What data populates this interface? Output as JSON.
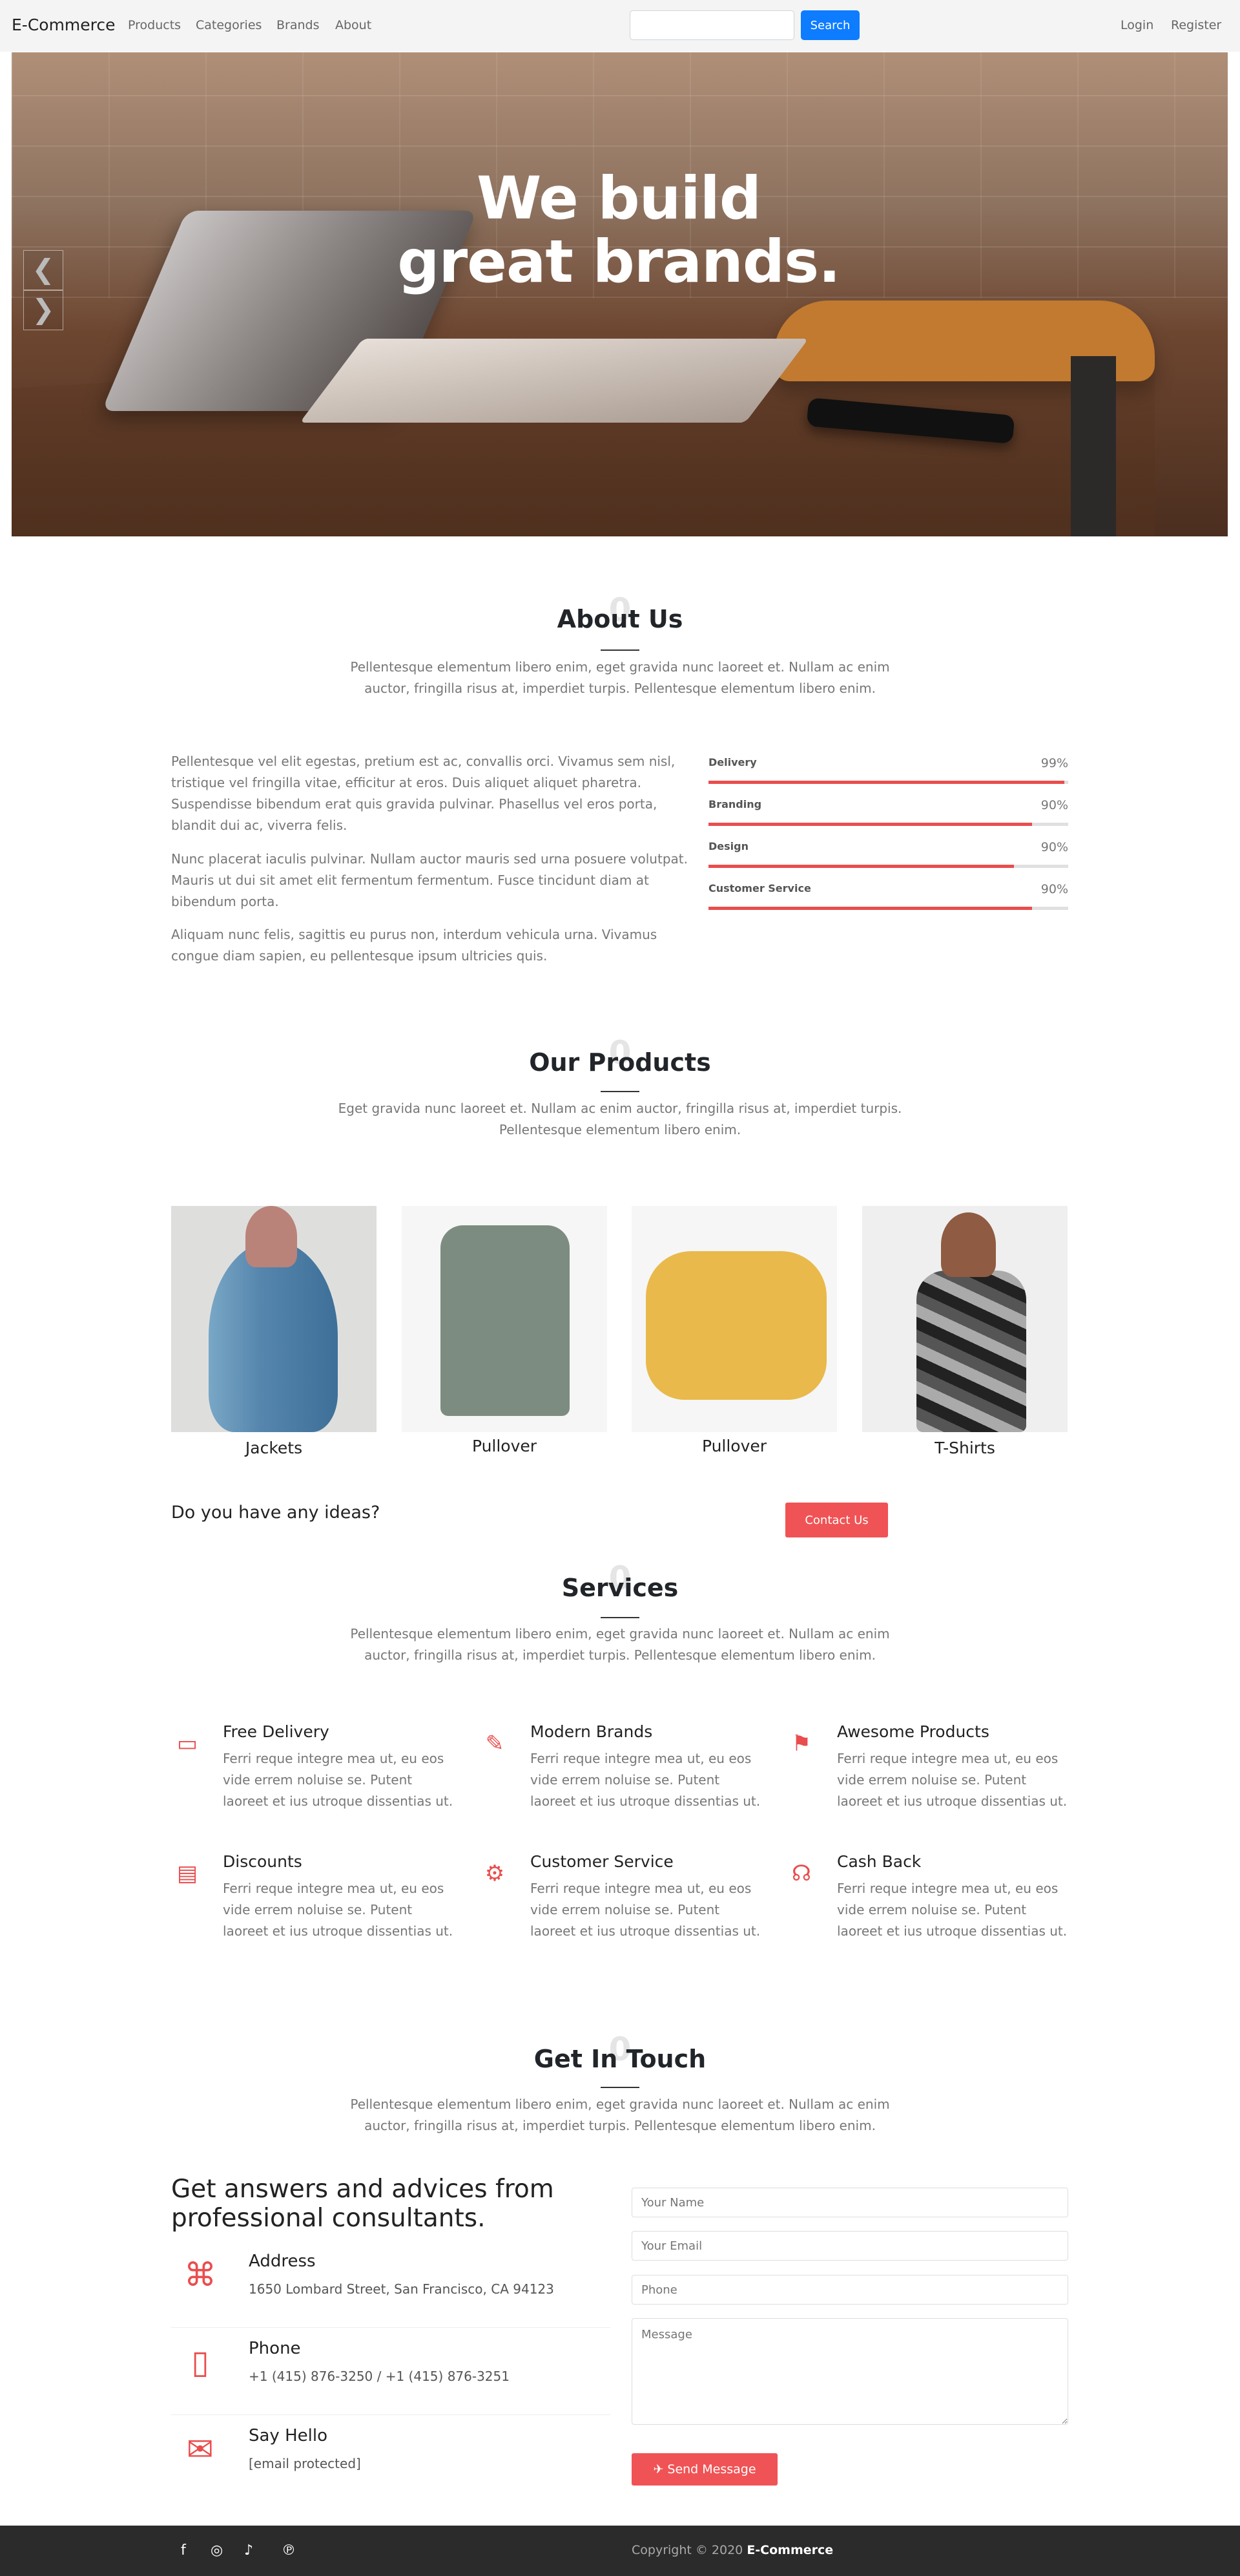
{
  "nav": {
    "brand": "E-Commerce",
    "links": [
      "Products",
      "Categories",
      "Brands",
      "About"
    ],
    "search_placeholder": "",
    "search_button": "Search",
    "login": "Login",
    "register": "Register"
  },
  "hero": {
    "headline": "We build great brands.",
    "prev": "❮",
    "next": "❯"
  },
  "about": {
    "title": "About Us",
    "number": "0",
    "subtitle": "Pellentesque elementum libero enim, eget gravida nunc laoreet et. Nullam ac enim auctor, fringilla risus at, imperdiet turpis. Pellentesque elementum libero enim.",
    "paragraphs": [
      "Pellentesque vel elit egestas, pretium est ac, convallis orci. Vivamus sem nisl, tristique vel fringilla vitae, efficitur at eros. Duis aliquet aliquet pharetra. Suspendisse bibendum erat quis gravida pulvinar. Phasellus vel eros porta, blandit dui ac, viverra felis.",
      "Nunc placerat iaculis pulvinar. Nullam auctor mauris sed urna posuere volutpat. Mauris ut dui sit amet elit fermentum fermentum. Fusce tincidunt diam at bibendum porta.",
      "Aliquam nunc felis, sagittis eu purus non, interdum vehicula urna. Vivamus congue diam sapien, eu pellentesque ipsum ultricies quis."
    ],
    "skills": [
      {
        "label": "Delivery",
        "value": "99%",
        "fill": 99
      },
      {
        "label": "Branding",
        "value": "90%",
        "fill": 90
      },
      {
        "label": "Design",
        "value": "90%",
        "fill": 85
      },
      {
        "label": "Customer Service",
        "value": "90%",
        "fill": 90
      }
    ]
  },
  "products": {
    "title": "Our Products",
    "number": "0",
    "subtitle": "Eget gravida nunc laoreet et. Nullam ac enim auctor, fringilla risus at, imperdiet turpis. Pellentesque elementum libero enim.",
    "items": [
      "Jackets",
      "Pullover",
      "Pullover",
      "T-Shirts"
    ],
    "cta_text": "Do you have any ideas?",
    "cta_button": "Contact Us"
  },
  "services": {
    "title": "Services",
    "number": "0",
    "subtitle": "Pellentesque elementum libero enim, eget gravida nunc laoreet et. Nullam ac enim auctor, fringilla risus at, imperdiet turpis. Pellentesque elementum libero enim.",
    "items": [
      {
        "title": "Free Delivery",
        "text": "Ferri reque integre mea ut, eu eos vide errem noluise se. Putent laoreet et ius utroque dissentias ut.",
        "icon": "laptop-icon"
      },
      {
        "title": "Modern Brands",
        "text": "Ferri reque integre mea ut, eu eos vide errem noluise se. Putent laoreet et ius utroque dissentias ut.",
        "icon": "pencil-ruler-icon"
      },
      {
        "title": "Awesome Products",
        "text": "Ferri reque integre mea ut, eu eos vide errem noluise se. Putent laoreet et ius utroque dissentias ut.",
        "icon": "flag-icon"
      },
      {
        "title": "Discounts",
        "text": "Ferri reque integre mea ut, eu eos vide errem noluise se. Putent laoreet et ius utroque dissentias ut.",
        "icon": "id-card-icon"
      },
      {
        "title": "Customer Service",
        "text": "Ferri reque integre mea ut, eu eos vide errem noluise se. Putent laoreet et ius utroque dissentias ut.",
        "icon": "gear-icon"
      },
      {
        "title": "Cash Back",
        "text": "Ferri reque integre mea ut, eu eos vide errem noluise se. Putent laoreet et ius utroque dissentias ut.",
        "icon": "headset-icon"
      }
    ]
  },
  "contact": {
    "title": "Get In Touch",
    "number": "0",
    "subtitle": "Pellentesque elementum libero enim, eget gravida nunc laoreet et. Nullam ac enim auctor, fringilla risus at, imperdiet turpis. Pellentesque elementum libero enim.",
    "headline": "Get answers and advices from professional consultants.",
    "address_title": "Address",
    "address": "1650 Lombard Street, San Francisco, CA 94123",
    "phone_title": "Phone",
    "phone": "+1 (415) 876-3250 / +1 (415) 876-3251",
    "hello_title": "Say Hello",
    "email": "[email protected]",
    "placeholders": {
      "name": "Your Name",
      "email": "Your Email",
      "phone": "Phone",
      "message": "Message"
    },
    "send": "Send Message"
  },
  "footer": {
    "copyright_prefix": "Copyright © 2020 ",
    "brand": "E-Commerce"
  },
  "colors": {
    "accent": "#ea4d4d",
    "button_blue": "#0d7cff",
    "footer": "#2b2b2b"
  }
}
